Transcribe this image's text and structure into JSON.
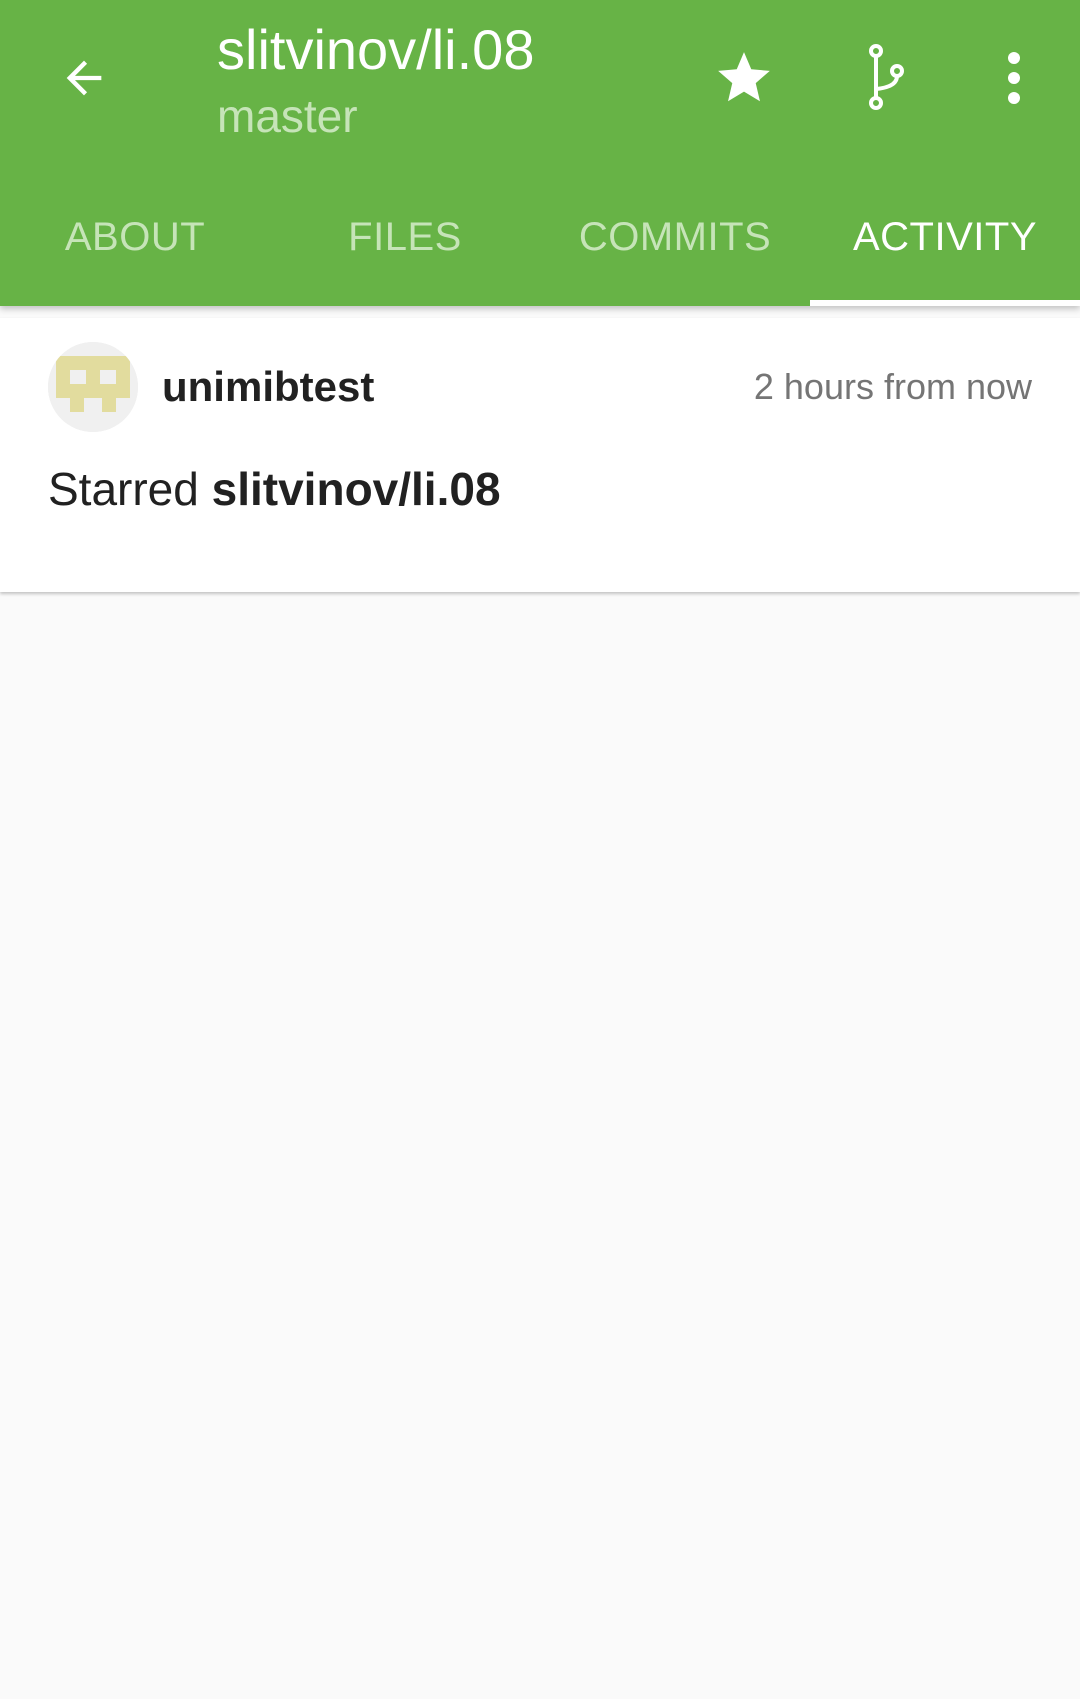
{
  "colors": {
    "app_bar": "#67b346",
    "tab_inactive_text": "#c6e4b8",
    "tab_active_text": "#ffffff",
    "background": "#fafafa"
  },
  "header": {
    "back_icon": "arrow-left-icon",
    "title": "slitvinov/li.08",
    "subtitle": "master",
    "actions": [
      {
        "icon": "star-icon"
      },
      {
        "icon": "git-branch-icon"
      },
      {
        "icon": "more-vertical-icon"
      }
    ]
  },
  "tabs": [
    {
      "label": "ABOUT",
      "active": false
    },
    {
      "label": "FILES",
      "active": false
    },
    {
      "label": "COMMITS",
      "active": false
    },
    {
      "label": "ACTIVITY",
      "active": true
    }
  ],
  "activity": {
    "items": [
      {
        "avatar_icon": "identicon-avatar",
        "user": "unimibtest",
        "time": "2 hours from now",
        "action": "Starred",
        "repo": "slitvinov/li.08"
      }
    ]
  }
}
